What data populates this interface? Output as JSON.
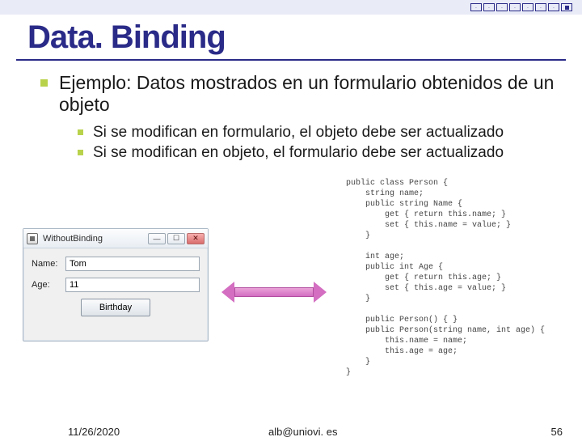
{
  "title": "Data. Binding",
  "navGroups": [
    {
      "items": [
        ".",
        ".",
        ".",
        ".",
        "."
      ]
    },
    {
      "items": [
        ".",
        ".",
        "stop"
      ]
    }
  ],
  "bullets": {
    "main": "Ejemplo: Datos mostrados en un formulario obtenidos de un objeto",
    "subs": [
      "Si se modifican en formulario, el objeto debe ser actualizado",
      "Si se modifican en objeto, el formulario debe ser actualizado"
    ]
  },
  "window": {
    "title": "WithoutBinding",
    "minGlyph": "—",
    "maxGlyph": "☐",
    "closeGlyph": "✕",
    "fields": {
      "nameLabel": "Name:",
      "nameValue": "Tom",
      "ageLabel": "Age:",
      "ageValue": "11"
    },
    "button": "Birthday"
  },
  "code": "public class Person {\n    string name;\n    public string Name {\n        get { return this.name; }\n        set { this.name = value; }\n    }\n\n    int age;\n    public int Age {\n        get { return this.age; }\n        set { this.age = value; }\n    }\n\n    public Person() { }\n    public Person(string name, int age) {\n        this.name = name;\n        this.age = age;\n    }\n}",
  "footer": {
    "date": "11/26/2020",
    "email": "alb@uniovi. es",
    "page": "56"
  }
}
